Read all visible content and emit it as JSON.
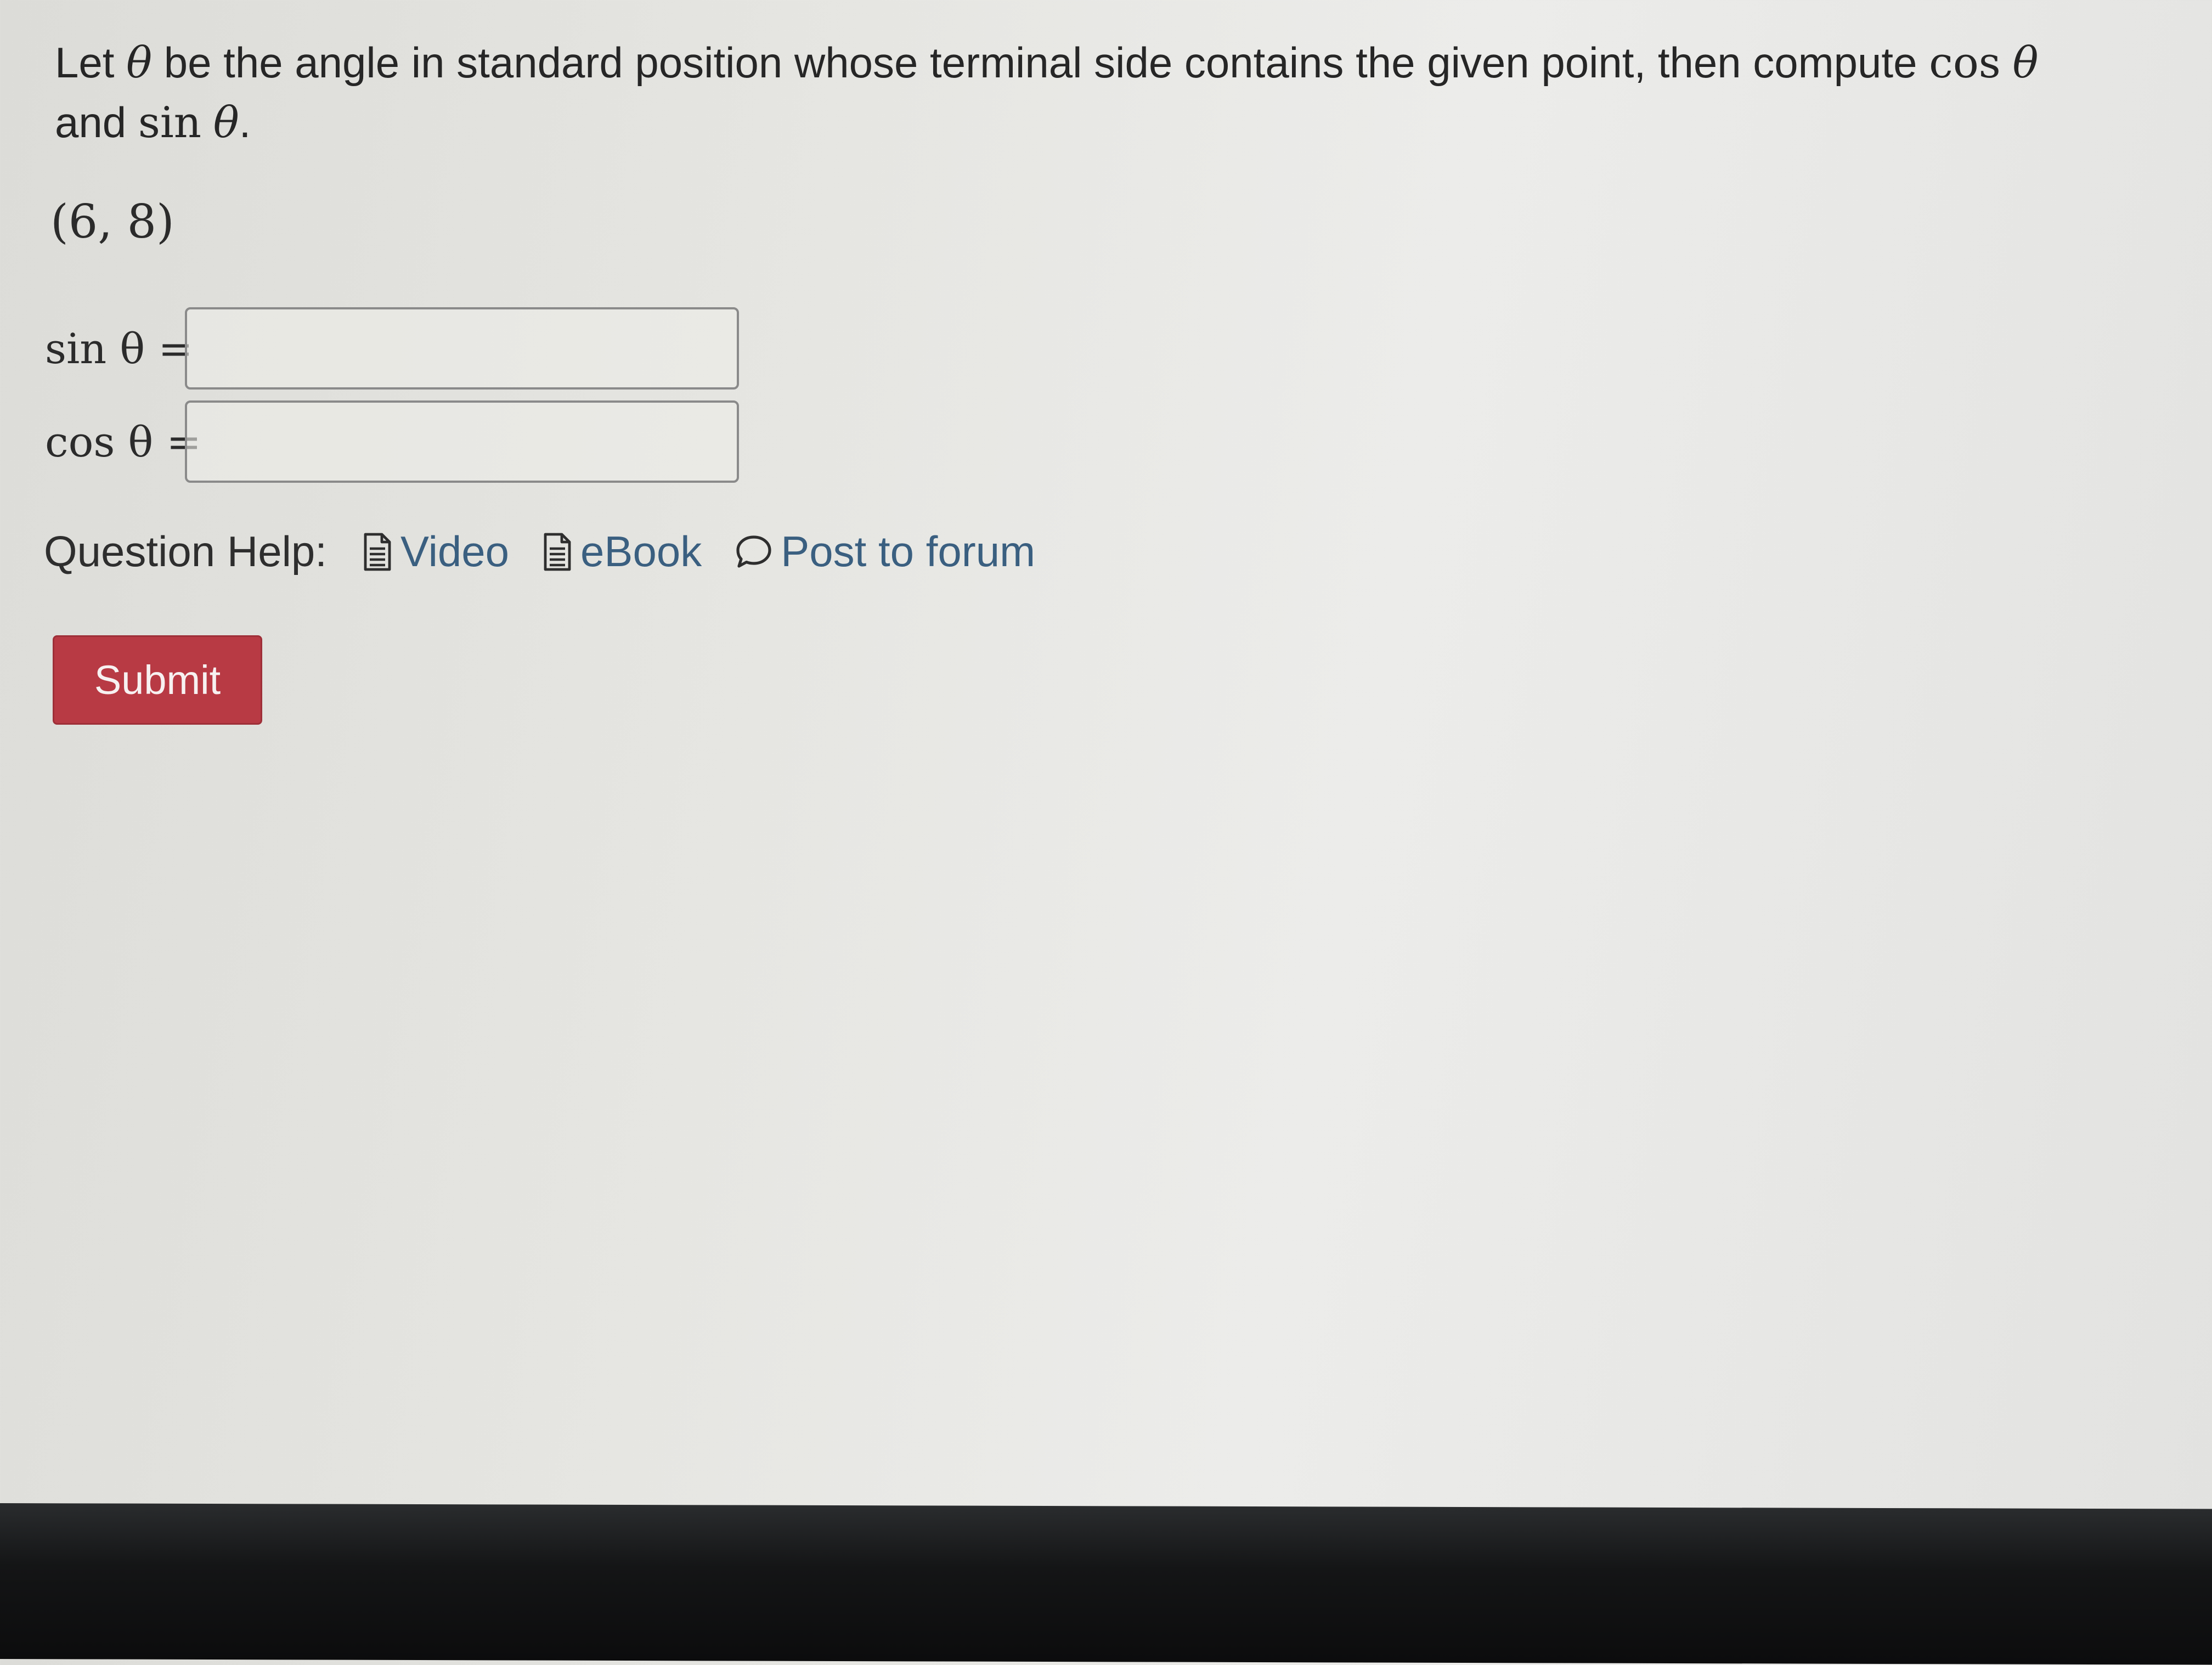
{
  "question": {
    "prefix": "Let ",
    "theta": "θ",
    "middle": " be the angle in standard position whose terminal side contains the given point, then compute ",
    "cos": "cos",
    "and": "and ",
    "sin": "sin",
    "period": "."
  },
  "point": "(6, 8)",
  "answers": {
    "sin_label": "sin θ =",
    "sin_value": "",
    "cos_label": "cos θ =",
    "cos_value": ""
  },
  "help": {
    "label": "Question Help:",
    "links": [
      {
        "label": "Video",
        "icon": "document-icon"
      },
      {
        "label": "eBook",
        "icon": "document-icon"
      },
      {
        "label": "Post to forum",
        "icon": "speech-bubble-icon"
      }
    ]
  },
  "submit": {
    "label": "Submit"
  },
  "colors": {
    "submit": "#b83a44",
    "link": "#3a5f80"
  }
}
